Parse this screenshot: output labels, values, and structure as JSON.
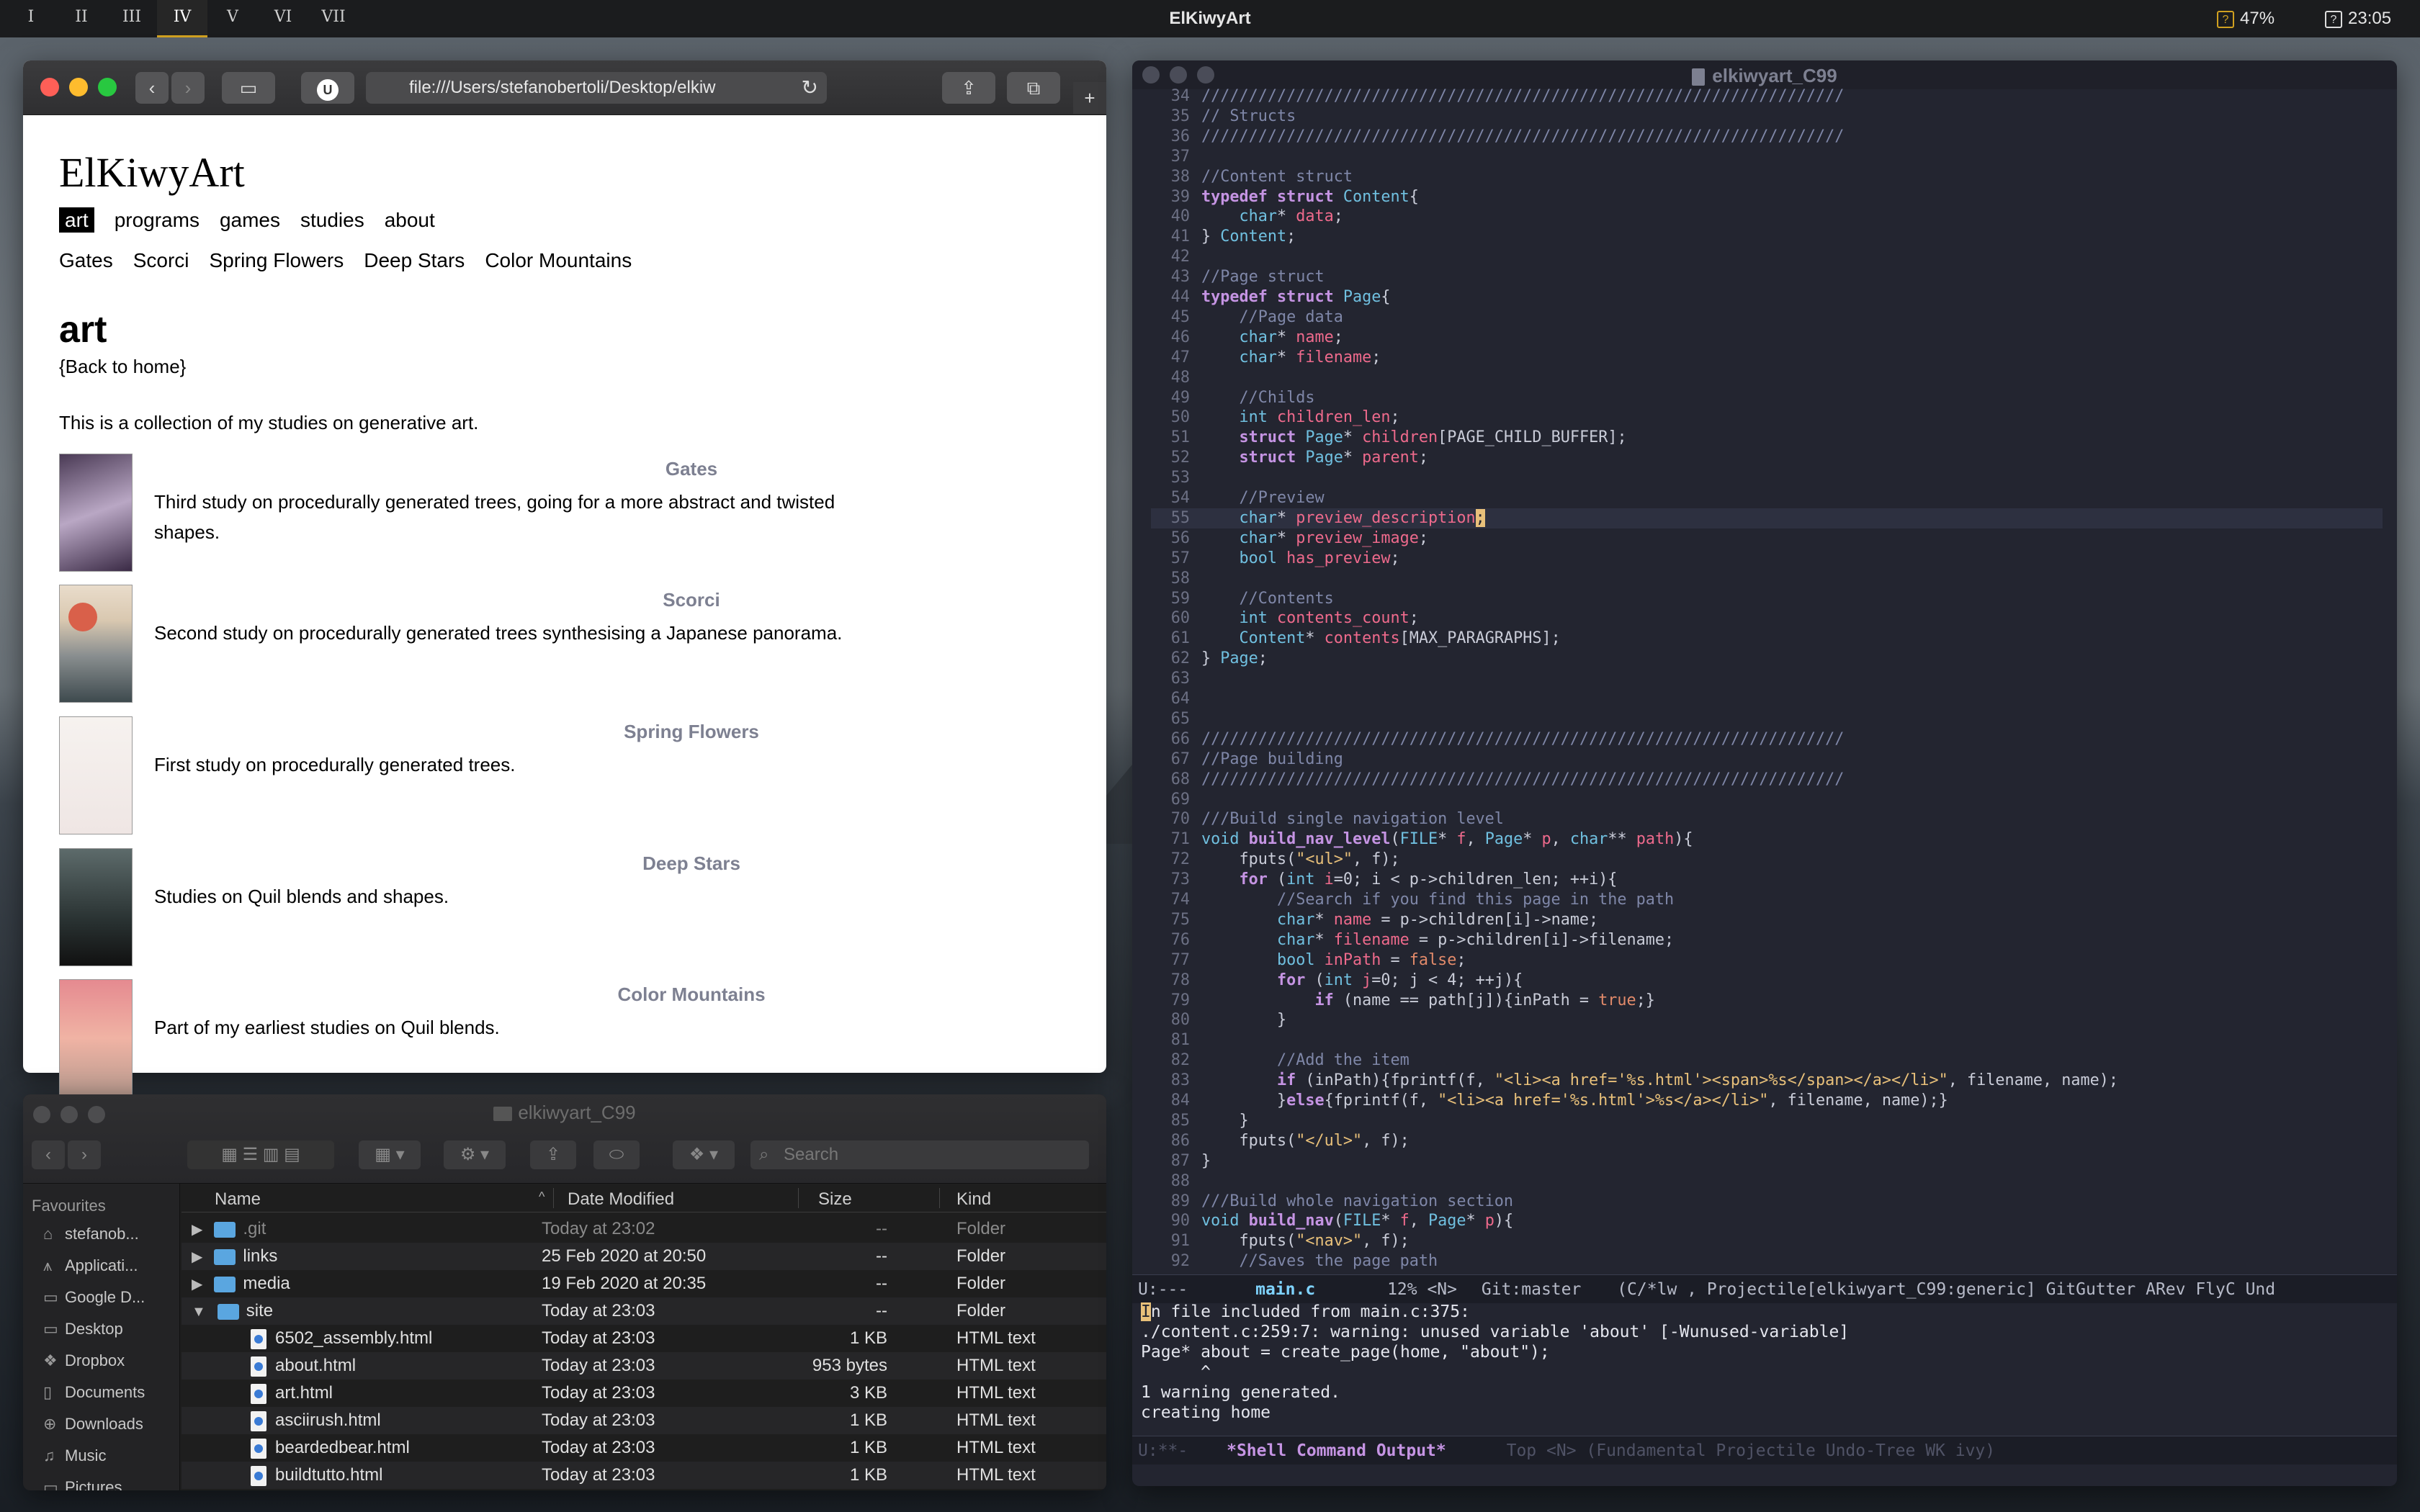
{
  "topbar": {
    "workspaces": [
      "I",
      "II",
      "III",
      "IV",
      "V",
      "VI",
      "VII"
    ],
    "active_workspace": "IV",
    "title": "ElKiwyArt",
    "battery": "47%",
    "clock": "23:05"
  },
  "browser": {
    "url": "file:///Users/stefanobertoli/Desktop/elkiw",
    "site_title": "ElKiwyArt",
    "nav": [
      "art",
      "programs",
      "games",
      "studies",
      "about"
    ],
    "subnav": [
      "Gates",
      "Scorci",
      "Spring Flowers",
      "Deep Stars",
      "Color Mountains"
    ],
    "section_title": "art",
    "back_link": "{Back to home}",
    "intro": "This is a collection of my studies on generative art.",
    "entries": [
      {
        "title": "Gates",
        "desc": "Third study on procedurally generated trees, going for a more abstract and twisted shapes."
      },
      {
        "title": "Scorci",
        "desc": "Second study on procedurally generated trees synthesising a Japanese panorama."
      },
      {
        "title": "Spring Flowers",
        "desc": "First study on procedurally generated trees."
      },
      {
        "title": "Deep Stars",
        "desc": "Studies on Quil blends and shapes."
      },
      {
        "title": "Color Mountains",
        "desc": "Part of my earliest studies on Quil blends."
      }
    ]
  },
  "finder": {
    "title": "elkiwyart_C99",
    "search_placeholder": "Search",
    "sidebar_header": "Favourites",
    "sidebar": [
      "stefanob...",
      "Applicati...",
      "Google D...",
      "Desktop",
      "Dropbox",
      "Documents",
      "Downloads",
      "Music",
      "Pictures"
    ],
    "columns": {
      "name": "Name",
      "date": "Date Modified",
      "size": "Size",
      "kind": "Kind"
    },
    "rows": [
      {
        "name": ".git",
        "date": "Today at 23:02",
        "size": "--",
        "kind": "Folder"
      },
      {
        "name": "links",
        "date": "25 Feb 2020 at 20:50",
        "size": "--",
        "kind": "Folder"
      },
      {
        "name": "media",
        "date": "19 Feb 2020 at 20:35",
        "size": "--",
        "kind": "Folder"
      },
      {
        "name": "site",
        "date": "Today at 23:03",
        "size": "--",
        "kind": "Folder"
      },
      {
        "name": "6502_assembly.html",
        "date": "Today at 23:03",
        "size": "1 KB",
        "kind": "HTML text"
      },
      {
        "name": "about.html",
        "date": "Today at 23:03",
        "size": "953 bytes",
        "kind": "HTML text"
      },
      {
        "name": "art.html",
        "date": "Today at 23:03",
        "size": "3 KB",
        "kind": "HTML text"
      },
      {
        "name": "asciirush.html",
        "date": "Today at 23:03",
        "size": "1 KB",
        "kind": "HTML text"
      },
      {
        "name": "beardedbear.html",
        "date": "Today at 23:03",
        "size": "1 KB",
        "kind": "HTML text"
      },
      {
        "name": "buildtutto.html",
        "date": "Today at 23:03",
        "size": "1 KB",
        "kind": "HTML text"
      }
    ]
  },
  "emacs": {
    "title": "elkiwyart_C99",
    "modeline": "U:---   main.c     12% <N>  Git:master   (C/*lw , Projectile[elkiwyart_C99:generic] GitGutter ARev FlyC Und",
    "modeline_buffer": "main.c",
    "shell_modeline_buffer": "*Shell Command Output*",
    "shell_modeline_rest": "Top <N>   (Fundamental Projectile Undo-Tree WK ivy)",
    "shell_output": [
      "In file included from main.c:375:",
      "./content.c:259:7: warning: unused variable 'about' [-Wunused-variable]",
      "Page* about = create_page(home, \"about\");",
      "      ^",
      "1 warning generated.",
      "creating home"
    ],
    "lines": [
      {
        "n": "34",
        "h": "<span class=\"cm\">////////////////////////////////////////////////////////////////////</span>"
      },
      {
        "n": "35",
        "h": "<span class=\"cm\">// Structs</span>"
      },
      {
        "n": "36",
        "h": "<span class=\"cm\">////////////////////////////////////////////////////////////////////</span>"
      },
      {
        "n": "37",
        "h": ""
      },
      {
        "n": "38",
        "h": "<span class=\"cm\">//Content struct</span>"
      },
      {
        "n": "39",
        "h": "<span class=\"k\">typedef struct</span> <span class=\"t\">Content</span>{"
      },
      {
        "n": "40",
        "h": "    <span class=\"t\">char</span>* <span class=\"v\">data</span>;"
      },
      {
        "n": "41",
        "h": "} <span class=\"t\">Content</span>;"
      },
      {
        "n": "42",
        "h": ""
      },
      {
        "n": "43",
        "h": "<span class=\"cm\">//Page struct</span>"
      },
      {
        "n": "44",
        "h": "<span class=\"k\">typedef struct</span> <span class=\"t\">Page</span>{"
      },
      {
        "n": "45",
        "h": "    <span class=\"cm\">//Page data</span>"
      },
      {
        "n": "46",
        "h": "    <span class=\"t\">char</span>* <span class=\"v\">name</span>;"
      },
      {
        "n": "47",
        "h": "    <span class=\"t\">char</span>* <span class=\"v\">filename</span>;"
      },
      {
        "n": "48",
        "h": ""
      },
      {
        "n": "49",
        "h": "    <span class=\"cm\">//Childs</span>"
      },
      {
        "n": "50",
        "h": "    <span class=\"t\">int</span> <span class=\"v\">children_len</span>;"
      },
      {
        "n": "51",
        "h": "    <span class=\"k\">struct</span> <span class=\"t\">Page</span>* <span class=\"v\">children</span>[PAGE_CHILD_BUFFER];"
      },
      {
        "n": "52",
        "h": "    <span class=\"k\">struct</span> <span class=\"t\">Page</span>* <span class=\"v\">parent</span>;"
      },
      {
        "n": "53",
        "h": ""
      },
      {
        "n": "54",
        "h": "    <span class=\"cm\">//Preview</span>"
      },
      {
        "n": "55",
        "h": "    <span class=\"t\">char</span>* <span class=\"v\">preview_description</span><span class=\"cursor\">;</span>"
      },
      {
        "n": "56",
        "h": "    <span class=\"t\">char</span>* <span class=\"v\">preview_image</span>;"
      },
      {
        "n": "57",
        "h": "    <span class=\"t\">bool</span> <span class=\"v\">has_preview</span>;"
      },
      {
        "n": "58",
        "h": ""
      },
      {
        "n": "59",
        "h": "    <span class=\"cm\">//Contents</span>"
      },
      {
        "n": "60",
        "h": "    <span class=\"t\">int</span> <span class=\"v\">contents_count</span>;"
      },
      {
        "n": "61",
        "h": "    <span class=\"t\">Content</span>* <span class=\"v\">contents</span>[MAX_PARAGRAPHS];"
      },
      {
        "n": "62",
        "h": "} <span class=\"t\">Page</span>;"
      },
      {
        "n": "63",
        "h": ""
      },
      {
        "n": "64",
        "h": ""
      },
      {
        "n": "65",
        "h": ""
      },
      {
        "n": "66",
        "h": "<span class=\"cm\">////////////////////////////////////////////////////////////////////</span>"
      },
      {
        "n": "67",
        "h": "<span class=\"cm\">//Page building</span>"
      },
      {
        "n": "68",
        "h": "<span class=\"cm\">////////////////////////////////////////////////////////////////////</span>"
      },
      {
        "n": "69",
        "h": ""
      },
      {
        "n": "70",
        "h": "<span class=\"cm\">///Build single navigation level</span>"
      },
      {
        "n": "71",
        "h": "<span class=\"t\">void</span> <span class=\"k\">build_nav_level</span>(<span class=\"t\">FILE</span>* <span class=\"v\">f</span>, <span class=\"t\">Page</span>* <span class=\"v\">p</span>, <span class=\"t\">char</span>** <span class=\"v\">path</span>){"
      },
      {
        "n": "72",
        "h": "    fputs(<span class=\"s\">\"&lt;ul&gt;\"</span>, f);"
      },
      {
        "n": "73",
        "h": "    <span class=\"k\">for</span> (<span class=\"t\">int</span> <span class=\"v\">i</span>=0; i &lt; p-&gt;children_len; ++i){"
      },
      {
        "n": "74",
        "h": "        <span class=\"cm\">//Search if you find this page in the path</span>"
      },
      {
        "n": "75",
        "h": "        <span class=\"t\">char</span>* <span class=\"v\">name</span> = p-&gt;children[i]-&gt;name;"
      },
      {
        "n": "76",
        "h": "        <span class=\"t\">char</span>* <span class=\"v\">filename</span> = p-&gt;children[i]-&gt;filename;"
      },
      {
        "n": "77",
        "h": "        <span class=\"t\">bool</span> <span class=\"v\">inPath</span> = <span class=\"tr\">false</span>;"
      },
      {
        "n": "78",
        "h": "        <span class=\"k\">for</span> (<span class=\"t\">int</span> <span class=\"v\">j</span>=0; j &lt; 4; ++j){"
      },
      {
        "n": "79",
        "h": "            <span class=\"k\">if</span> (name == path[j]){inPath = <span class=\"tr\">true</span>;}"
      },
      {
        "n": "80",
        "h": "        }"
      },
      {
        "n": "81",
        "h": ""
      },
      {
        "n": "82",
        "h": "        <span class=\"cm\">//Add the item</span>"
      },
      {
        "n": "83",
        "h": "        <span class=\"k\">if</span> (inPath){fprintf(f, <span class=\"s\">\"&lt;li&gt;&lt;a href='%s.html'&gt;&lt;span&gt;%s&lt;/span&gt;&lt;/a&gt;&lt;/li&gt;\"</span>, filename, name);"
      },
      {
        "n": "84",
        "h": "        }<span class=\"k\">else</span>{fprintf(f, <span class=\"s\">\"&lt;li&gt;&lt;a href='%s.html'&gt;%s&lt;/a&gt;&lt;/li&gt;\"</span>, filename, name);}"
      },
      {
        "n": "85",
        "h": "    }"
      },
      {
        "n": "86",
        "h": "    fputs(<span class=\"s\">\"&lt;/ul&gt;\"</span>, f);"
      },
      {
        "n": "87",
        "h": "}"
      },
      {
        "n": "88",
        "h": ""
      },
      {
        "n": "89",
        "h": "<span class=\"cm\">///Build whole navigation section</span>"
      },
      {
        "n": "90",
        "h": "<span class=\"t\">void</span> <span class=\"k\">build_nav</span>(<span class=\"t\">FILE</span>* <span class=\"v\">f</span>, <span class=\"t\">Page</span>* <span class=\"v\">p</span>){"
      },
      {
        "n": "91",
        "h": "    fputs(<span class=\"s\">\"&lt;nav&gt;\"</span>, f);"
      },
      {
        "n": "92",
        "h": "    <span class=\"cm\">//Saves the page path</span>"
      }
    ]
  }
}
